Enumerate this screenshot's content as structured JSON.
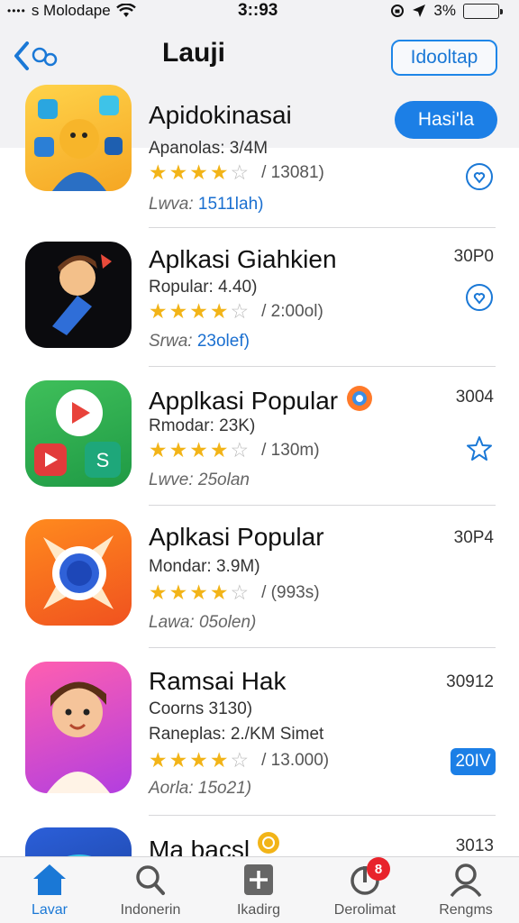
{
  "status_bar": {
    "carrier": "s Molodape",
    "time": "3::93",
    "battery": "3%",
    "signal_icon": "signal-dots-icon",
    "wifi_icon": "wifi-icon",
    "location_icon": "location-arrow-icon",
    "lock_icon": "rotation-lock-icon"
  },
  "nav": {
    "title": "Lauji",
    "action_label": "Idooltap",
    "back_icon": "chevron-left-icon"
  },
  "apps": [
    {
      "name": "Apidokinasai",
      "sub": "Apanolas: 3/4M",
      "rating_text": "/ 13081)",
      "meta_label": "Lwva:",
      "meta_value": "1511lah)",
      "button_label": "Hasi'la",
      "right_icon": "shield-heart-icon",
      "stars": 4
    },
    {
      "name": "Aplkasi Giahkien",
      "sub": "Ropular: 4.40)",
      "rating_text": "/ 2:00ol)",
      "meta_label": "Srwa:",
      "meta_value": "23olef)",
      "right_num": "30P0",
      "right_icon": "shield-heart-icon",
      "stars": 4
    },
    {
      "name": "Applkasi Popular",
      "sub": "Rmodar: 23K)",
      "rating_text": "/ 130m)",
      "meta_label": "Lwve:",
      "meta_value": "25olan",
      "right_num": "3004",
      "right_icon": "star-outline-icon",
      "stars": 4
    },
    {
      "name": "Aplkasi Popular",
      "sub": "Mondar: 3.9M)",
      "rating_text": "/ (993s)",
      "meta_label": "Lawa:",
      "meta_value": "05olen)",
      "right_num": "30P4",
      "stars": 4
    },
    {
      "name": "Ramsai Hak",
      "sub": "Coorns 3130)",
      "sub2": "Raneplas: 2./KM Simet",
      "rating_text": "/ 13.000)",
      "meta_label": "Aorla:",
      "meta_value": "15o21)",
      "right_num": "30912",
      "badge_label": "20IV",
      "stars": 4
    },
    {
      "name": "Ma bacsl",
      "right_num": "3013"
    }
  ],
  "tabs": [
    {
      "label": "Lavar",
      "icon": "home-icon",
      "active": true
    },
    {
      "label": "Indonerin",
      "icon": "search-icon"
    },
    {
      "label": "Ikadirg",
      "icon": "plus-box-icon"
    },
    {
      "label": "Derolimat",
      "icon": "power-icon",
      "badge": "8"
    },
    {
      "label": "Rengms",
      "icon": "user-icon"
    }
  ],
  "colors": {
    "accent": "#1c7fe6",
    "star": "#f2b418",
    "badge_red": "#e8232b"
  }
}
